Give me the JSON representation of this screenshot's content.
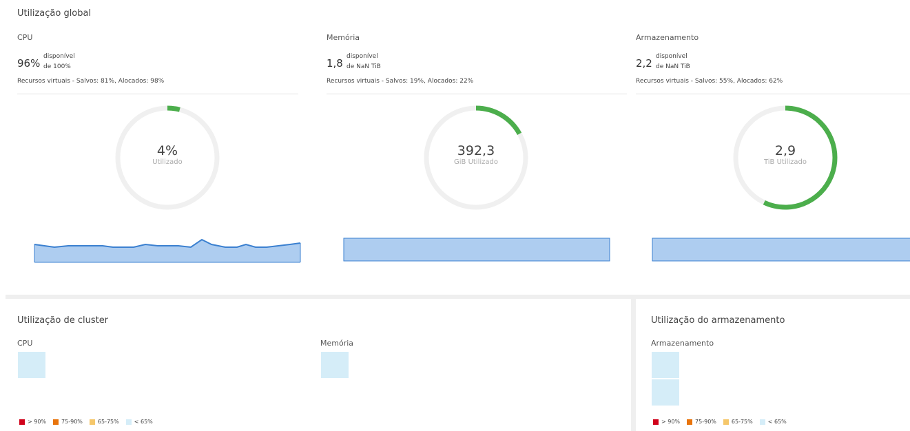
{
  "global": {
    "title": "Utilização global"
  },
  "metrics": [
    {
      "id": "cpu",
      "title": "CPU",
      "available": "96%",
      "available_label": "disponível",
      "of_total": "de 100%",
      "virtual": "Recursos virtuais - Salvos: 81%, Alocados: 98%",
      "used_value": "4%",
      "used_label": "Utilizado",
      "used_fraction": 0.04
    },
    {
      "id": "memory",
      "title": "Memória",
      "available": "1,8",
      "available_label": "disponível",
      "of_total": "de NaN TiB",
      "virtual": "Recursos virtuais - Salvos: 19%, Alocados: 22%",
      "used_value": "392,3",
      "used_label": "GiB Utilizado",
      "used_fraction": 0.17
    },
    {
      "id": "storage",
      "title": "Armazenamento",
      "available": "2,2",
      "available_label": "disponível",
      "of_total": "de NaN TiB",
      "virtual": "Recursos virtuais - Salvos: 55%, Alocados: 62%",
      "used_value": "2,9",
      "used_label": "TiB Utilizado",
      "used_fraction": 0.57
    }
  ],
  "cluster": {
    "title": "Utilização de cluster",
    "cpu_label": "CPU",
    "memory_label": "Memória"
  },
  "storage_util": {
    "title": "Utilização do armazenamento",
    "storage_label": "Armazenamento"
  },
  "legend": [
    {
      "label": "> 90%",
      "color": "#d0021b"
    },
    {
      "label": "75-90%",
      "color": "#e8740c"
    },
    {
      "label": "65-75%",
      "color": "#f5c76b"
    },
    {
      "label": "< 65%",
      "color": "#d5edf8"
    }
  ],
  "colors": {
    "donut_fill": "#4cae4c",
    "donut_track": "#f0f0f0",
    "spark_fill": "#aecdf0",
    "spark_line": "#3b80d0"
  }
}
